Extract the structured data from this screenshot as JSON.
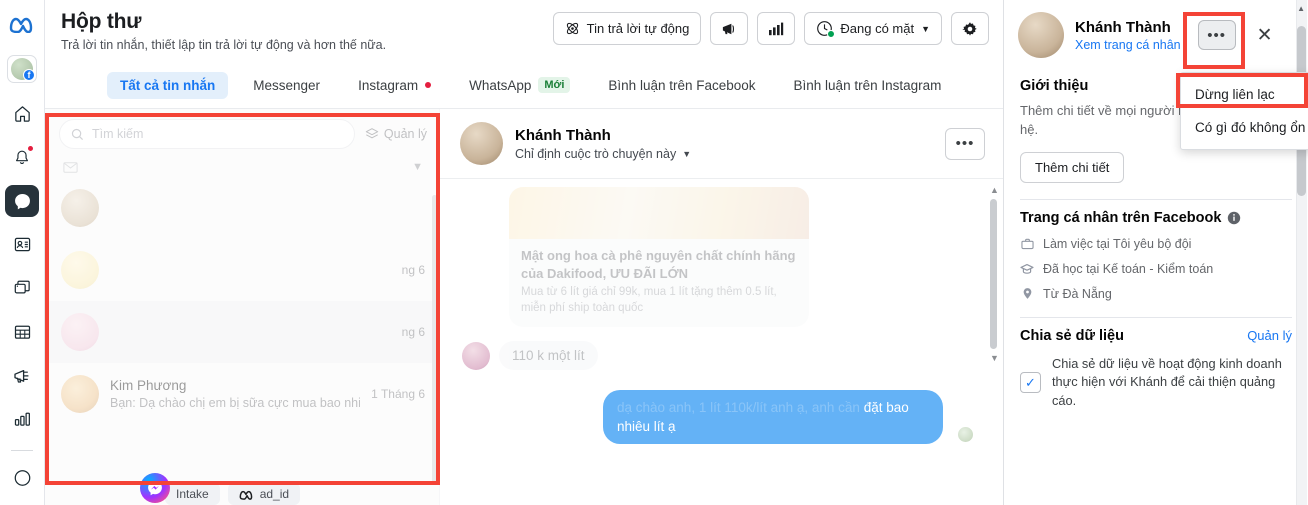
{
  "rail": {
    "items": [
      {
        "name": "meta-logo",
        "label": "Meta"
      },
      {
        "name": "page-avatar",
        "label": "Trang"
      },
      {
        "name": "home",
        "label": "Trang chủ"
      },
      {
        "name": "notifications",
        "label": "Thông báo"
      },
      {
        "name": "inbox",
        "label": "Hộp thư"
      },
      {
        "name": "contacts",
        "label": "Danh bạ"
      },
      {
        "name": "posts",
        "label": "Bài viết"
      },
      {
        "name": "planner",
        "label": "Lịch"
      },
      {
        "name": "ads",
        "label": "Quảng cáo"
      },
      {
        "name": "insights",
        "label": "Thông tin chi tiết"
      }
    ]
  },
  "header": {
    "title": "Hộp thư",
    "subtitle": "Trả lời tin nhắn, thiết lập tin trả lời tự động và hơn thế nữa.",
    "actions": {
      "automated": "Tin trả lời tự động",
      "announce_icon": "megaphone-icon",
      "insights_icon": "bar-chart-icon",
      "presence": "Đang có mặt",
      "settings_icon": "gear-icon"
    }
  },
  "tabs": [
    {
      "label": "Tất cả tin nhắn",
      "active": true,
      "dot": false,
      "badge": ""
    },
    {
      "label": "Messenger",
      "active": false,
      "dot": false,
      "badge": ""
    },
    {
      "label": "Instagram",
      "active": false,
      "dot": true,
      "badge": ""
    },
    {
      "label": "WhatsApp",
      "active": false,
      "dot": false,
      "badge": "Mới"
    },
    {
      "label": "Bình luận trên Facebook",
      "active": false,
      "dot": false,
      "badge": ""
    },
    {
      "label": "Bình luận trên Instagram",
      "active": false,
      "dot": false,
      "badge": ""
    }
  ],
  "conversations": {
    "search_placeholder": "Tìm kiếm",
    "manage_label": "Quản lý",
    "rows": [
      {
        "name": "",
        "snippet": "",
        "time": "",
        "avatar": "av-a"
      },
      {
        "name": "",
        "snippet": "",
        "time": "ng 6",
        "avatar": "av-b"
      },
      {
        "name": "",
        "snippet": "",
        "time": "ng 6",
        "avatar": "av-c"
      },
      {
        "name": "Kim Phương",
        "snippet": "Bạn: Dạ chào chị em bị sữa cực mua bao nhiêu",
        "time": "1 Tháng 6",
        "avatar": "av-d"
      }
    ]
  },
  "thread": {
    "name": "Khánh Thành",
    "assign": "Chỉ định cuộc trò chuyện này",
    "more_icon": "ellipsis-icon",
    "card": {
      "title": "Mật ong hoa cà phê nguyên chất chính hãng của Dakifood, ƯU ĐÃI LỚN",
      "desc": "Mua từ 6 lít giá chỉ 99k, mua 1 lít tặng thêm 0.5 lít, miễn phí ship toàn quốc"
    },
    "messages": [
      {
        "dir": "in",
        "text": "110 k một lít"
      },
      {
        "dir": "out",
        "text_faded": "dạ chào anh, 1 lít 110k/lít anh ạ, anh cần ",
        "text": "đặt bao nhiêu lít ạ"
      }
    ]
  },
  "bottom_chips": [
    {
      "label": "Intake"
    },
    {
      "label": "ad_id",
      "icon": "meta-icon"
    }
  ],
  "right_panel": {
    "name": "Khánh Thành",
    "profile_link": "Xem trang cá nhân",
    "more_icon": "ellipsis-icon",
    "close_icon": "close-icon",
    "about": {
      "heading": "Giới thiệu",
      "body": "Thêm chi tiết về mọi người như thông tin liên hệ.",
      "button": "Thêm chi tiết"
    },
    "facebook_profile": {
      "heading": "Trang cá nhân trên Facebook",
      "info_icon": "info-icon",
      "items": [
        {
          "icon": "briefcase-icon",
          "label": "Làm việc tại Tôi yêu bộ đội"
        },
        {
          "icon": "graduation-cap-icon",
          "label": "Đã học tại Kế toán - Kiểm toán"
        },
        {
          "icon": "location-pin-icon",
          "label": "Từ Đà Nẵng"
        }
      ]
    },
    "data_sharing": {
      "heading": "Chia sẻ dữ liệu",
      "manage": "Quản lý",
      "checkbox_checked": true,
      "checkbox_label": "Chia sẻ dữ liệu về hoạt động kinh doanh thực hiện với Khánh để cải thiện quảng cáo."
    }
  },
  "dropdown": {
    "items": [
      {
        "label": "Dừng liên lạc",
        "highlighted": true
      },
      {
        "label": "Có gì đó không ổn",
        "highlighted": false
      }
    ]
  },
  "colors": {
    "accent_blue": "#1877f2",
    "bubble_blue": "#64b2f6",
    "annotation_red": "#f44336",
    "badge_green": "#1a7f37",
    "dot_red": "#e41e3f"
  }
}
